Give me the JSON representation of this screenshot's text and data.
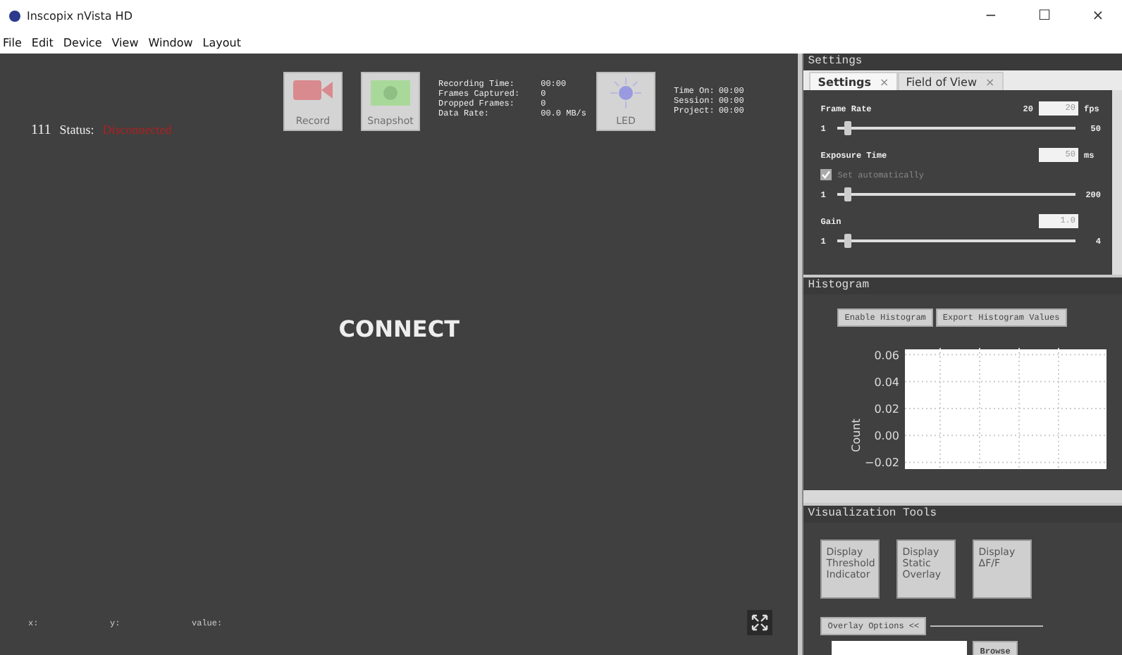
{
  "window": {
    "title": "Inscopix nVista HD",
    "controls": [
      "−",
      "☐",
      "×"
    ]
  },
  "menu": [
    "File",
    "Edit",
    "Device",
    "View",
    "Window",
    "Layout"
  ],
  "status": {
    "id": "111",
    "label": "Status:",
    "value": "Disconnected"
  },
  "toolbar": [
    {
      "kind": "record",
      "label": "Record",
      "disabled": true
    },
    {
      "kind": "snapshot",
      "label": "Snapshot",
      "disabled": true
    }
  ],
  "recording_stats": [
    {
      "label": "Recording Time:",
      "value": "00:00"
    },
    {
      "label": "Frames Captured:",
      "value": "0"
    },
    {
      "label": "Dropped Frames:",
      "value": "0"
    },
    {
      "label": "Data Rate:",
      "value": "00.0 MB/s"
    }
  ],
  "led": {
    "label": "LED",
    "disabled": true
  },
  "timers": [
    {
      "label": "Time On:",
      "value": "00:00"
    },
    {
      "label": "Session:",
      "value": "00:00"
    },
    {
      "label": "Project:",
      "value": "00:00"
    }
  ],
  "center_text": "CONNECT",
  "coords": [
    "x:",
    "y:",
    "value:"
  ],
  "settings": {
    "title": "Settings",
    "tabs": [
      {
        "label": "Settings",
        "selected": true,
        "close": "×"
      },
      {
        "label": "Field of View",
        "selected": false,
        "close": "×"
      }
    ],
    "controls": [
      {
        "kind": "slider",
        "label": "Frame Rate",
        "reading": "20",
        "input": "20",
        "unit": "fps",
        "min": "1",
        "max": "50",
        "level": 0.03
      },
      {
        "kind": "slider",
        "label": "Exposure Time",
        "checkbox": {
          "label": "Set automatically",
          "checked": true,
          "disabled": true
        },
        "input": "50",
        "unit": "ms",
        "min": "1",
        "max": "200",
        "level": 0.03
      },
      {
        "kind": "slider",
        "label": "Gain",
        "input": "1.0",
        "min": "1",
        "max": "4",
        "level": 0.03
      }
    ]
  },
  "histogram": {
    "title": "Histogram",
    "buttons": [
      "Enable Histogram",
      "Export Histogram Values"
    ],
    "chart_data": {
      "type": "line",
      "categories": [
        null,
        null,
        null,
        null
      ],
      "grid": true,
      "ylabel": "Count",
      "ylim": [
        -0.025,
        0.065
      ],
      "yticks": [
        {
          "value": 0.06,
          "label": "0.06"
        },
        {
          "value": 0.04,
          "label": "0.04"
        },
        {
          "value": 0.02,
          "label": "0.02"
        },
        {
          "value": 0,
          "label": "0.00"
        },
        {
          "value": -0.02,
          "label": "−0.02"
        }
      ]
    }
  },
  "visualization": {
    "title": "Visualization Tools",
    "buttons": [
      "Display Threshold Indicator",
      "Display Static Overlay",
      "Display ΔF/F"
    ],
    "overlay_options": "Overlay Options <<",
    "browse": "Browse"
  }
}
